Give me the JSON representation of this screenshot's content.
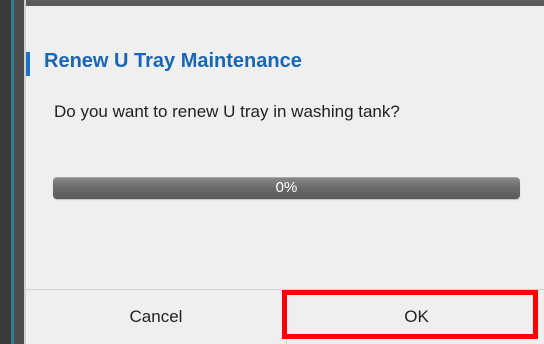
{
  "dialog": {
    "title": "Renew U Tray Maintenance",
    "message": "Do you want to renew U tray in washing tank?",
    "progress": {
      "value_percent": 0,
      "label": "0%"
    },
    "buttons": {
      "cancel_label": "Cancel",
      "ok_label": "OK"
    }
  },
  "colors": {
    "title": "#1766b7",
    "highlight": "#ff0000",
    "dialog_background": "#efefef"
  }
}
